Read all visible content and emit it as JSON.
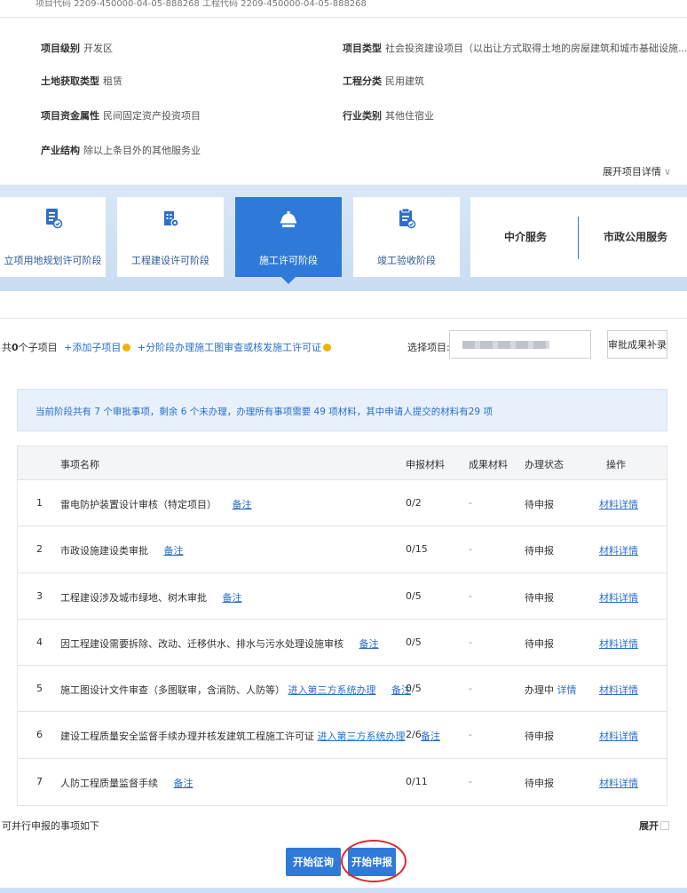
{
  "topbar": {
    "code_text": "项目代码 2209-450000-04-05-888268    工程代码 2209-450000-04-05-888268"
  },
  "project": {
    "fields": [
      {
        "label": "项目级别",
        "value": "开发区"
      },
      {
        "label": "项目类型",
        "value": "社会投资建设项目（以出让方式取得土地的房屋建筑和城市基础设施..."
      },
      {
        "label": "土地获取类型",
        "value": "租赁"
      },
      {
        "label": "工程分类",
        "value": "民用建筑"
      },
      {
        "label": "项目资金属性",
        "value": "民间固定资产投资项目"
      },
      {
        "label": "行业类别",
        "value": "其他住宿业"
      },
      {
        "label": "产业结构",
        "value": "除以上条目外的其他服务业"
      }
    ],
    "expand_label": "展开项目详情"
  },
  "stages": [
    {
      "label": "立项用地规划许可阶段",
      "icon": "document-check-icon"
    },
    {
      "label": "工程建设许可阶段",
      "icon": "building-gear-icon"
    },
    {
      "label": "施工许可阶段",
      "icon": "construction-helmet-icon"
    },
    {
      "label": "竣工验收阶段",
      "icon": "clipboard-check-icon"
    }
  ],
  "services": {
    "intermediary": "中介服务",
    "utility": "市政公用服务"
  },
  "subproject": {
    "count_prefix": "共",
    "count": "0",
    "count_suffix": "个子项目",
    "add_link": "+添加子项目",
    "phase_link": "+分阶段办理施工图审查或核发施工许可证",
    "select_label": "选择项目:",
    "result_button": "审批成果补录"
  },
  "notice": "当前阶段共有 7 个审批事项，剩余 6 个未办理，办理所有事项需要 49 项材料，其中申请人提交的材料有29 项",
  "table": {
    "headers": {
      "name": "事项名称",
      "materials": "申报材料",
      "results": "成果材料",
      "status": "办理状态",
      "op": "操作"
    },
    "rows": [
      {
        "num": "1",
        "name": "雷电防护装置设计审核（特定项目）",
        "extra": "",
        "note": "备注",
        "materials": "0/2",
        "results": "-",
        "status": "待申报",
        "status_link": "",
        "op": "材料详情"
      },
      {
        "num": "2",
        "name": "市政设施建设类审批",
        "extra": "",
        "note": "备注",
        "materials": "0/15",
        "results": "-",
        "status": "待申报",
        "status_link": "",
        "op": "材料详情"
      },
      {
        "num": "3",
        "name": "工程建设涉及城市绿地、树木审批",
        "extra": "",
        "note": "备注",
        "materials": "0/5",
        "results": "-",
        "status": "待申报",
        "status_link": "",
        "op": "材料详情"
      },
      {
        "num": "4",
        "name": "因工程建设需要拆除、改动、迁移供水、排水与污水处理设施审核",
        "extra": "",
        "note": "备注",
        "materials": "0/5",
        "results": "-",
        "status": "待申报",
        "status_link": "",
        "op": "材料详情"
      },
      {
        "num": "5",
        "name": "施工图设计文件审查（多图联审，含消防、人防等）",
        "extra": "进入第三方系统办理",
        "note": "备注",
        "materials": "0/5",
        "results": "-",
        "status": "办理中",
        "status_link": "详情",
        "op": "材料详情"
      },
      {
        "num": "6",
        "name": "建设工程质量安全监督手续办理并核发建筑工程施工许可证",
        "extra": "进入第三方系统办理",
        "note": "备注",
        "materials": "2/6",
        "results": "-",
        "status": "待申报",
        "status_link": "",
        "op": "材料详情"
      },
      {
        "num": "7",
        "name": "人防工程质量监督手续",
        "extra": "",
        "note": "备注",
        "materials": "0/11",
        "results": "-",
        "status": "待申报",
        "status_link": "",
        "op": "材料详情"
      }
    ]
  },
  "parallel_label": "可并行申报的事项如下",
  "expand2_label": "展开",
  "actions": {
    "consult": "开始征询",
    "apply": "开始申报"
  },
  "colors": {
    "accent": "#2f7ad8",
    "link": "#2b6fc9",
    "highlight_ring": "#e0262c"
  }
}
